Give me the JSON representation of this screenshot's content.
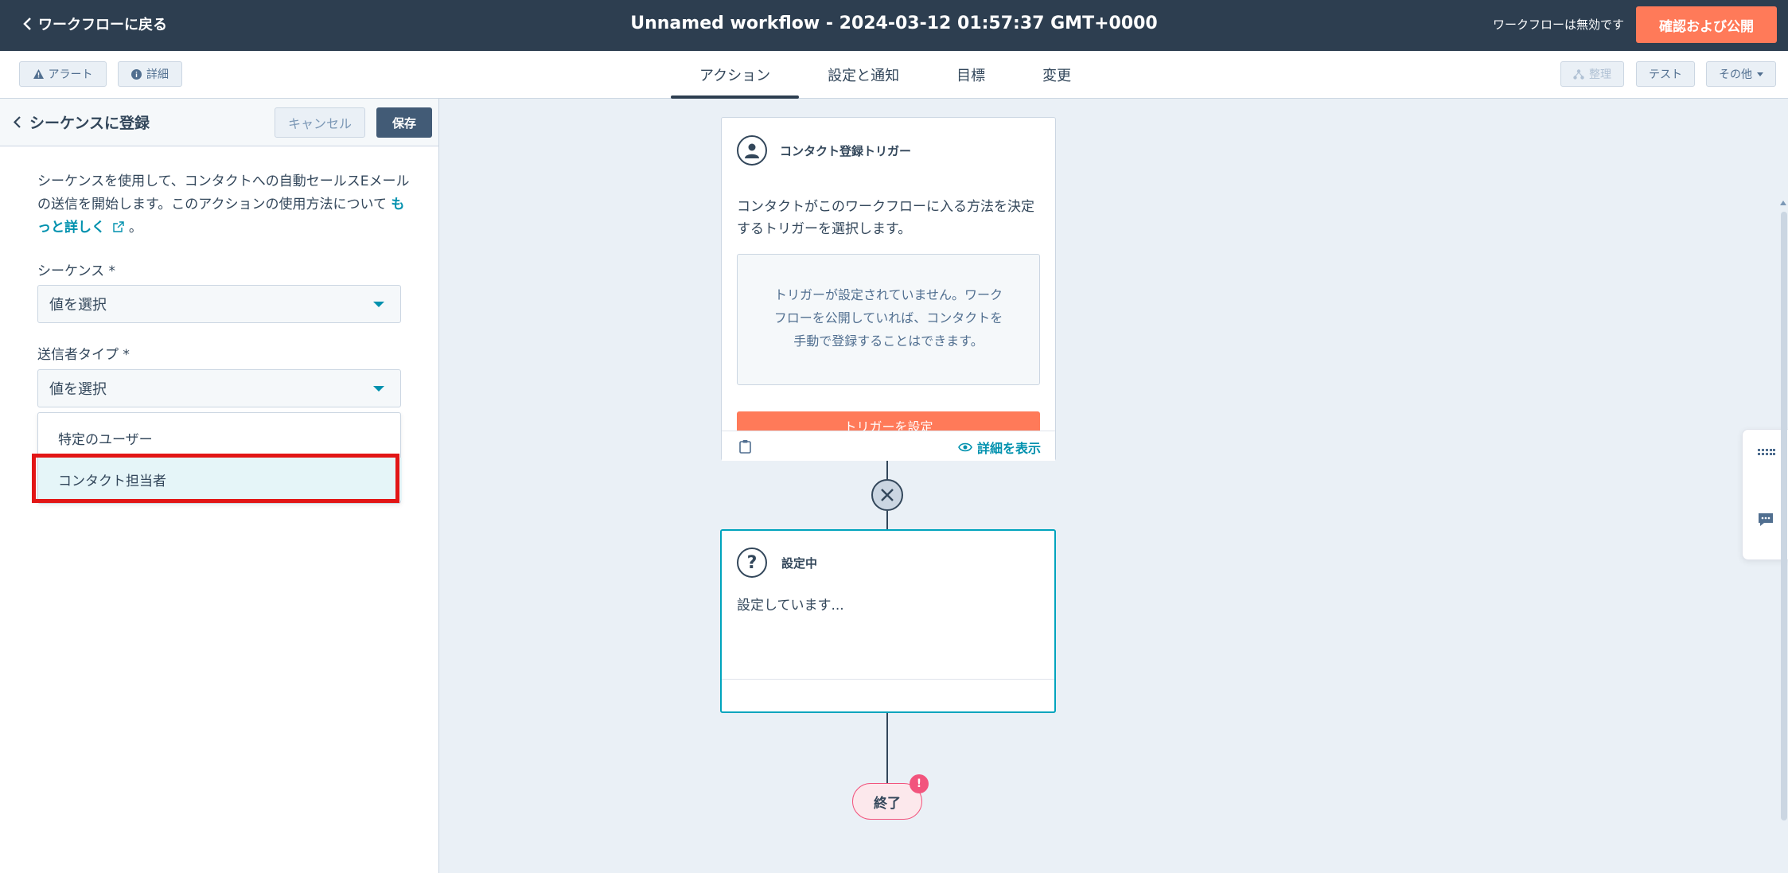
{
  "topbar": {
    "back_label": "ワークフローに戻る",
    "title": "Unnamed workflow - 2024-03-12 01:57:37 GMT+0000",
    "status": "ワークフローは無効です",
    "publish_label": "確認および公開"
  },
  "subbar": {
    "alert_label": "アラート",
    "details_label": "詳細",
    "tabs": [
      "アクション",
      "設定と通知",
      "目標",
      "変更"
    ],
    "active_tab": "アクション",
    "organize_label": "整理",
    "test_label": "テスト",
    "more_label": "その他"
  },
  "panel": {
    "title": "シーケンスに登録",
    "cancel_label": "キャンセル",
    "save_label": "保存",
    "description": "シーケンスを使用して、コンタクトへの自動セールスEメールの送信を開始します。このアクションの使用方法について",
    "learn_more": "もっと詳しく",
    "learn_more_suffix": "。",
    "sequence_label": "シーケンス *",
    "sequence_value": "値を選択",
    "sender_label": "送信者タイプ *",
    "sender_value": "値を選択",
    "dropdown_options": [
      "特定のユーザー",
      "コンタクト担当者"
    ],
    "highlighted_option": "コンタクト担当者"
  },
  "canvas": {
    "trigger_card": {
      "title": "コンタクト登録トリガー",
      "text": "コンタクトがこのワークフローに入る方法を決定するトリガーを選択します。",
      "empty_message": "トリガーが設定されていません。ワークフローを公開していれば、コンタクトを手動で登録することはできます。",
      "button_label": "トリガーを設定",
      "details_label": "詳細を表示"
    },
    "action_card": {
      "title": "設定中",
      "body": "設定しています..."
    },
    "end_label": "終了",
    "end_badge": "!"
  },
  "colors": {
    "topbar_bg": "#2d3e50",
    "accent_orange": "#ff7a59",
    "link_teal": "#0091ae",
    "highlight_red": "#e21616"
  }
}
